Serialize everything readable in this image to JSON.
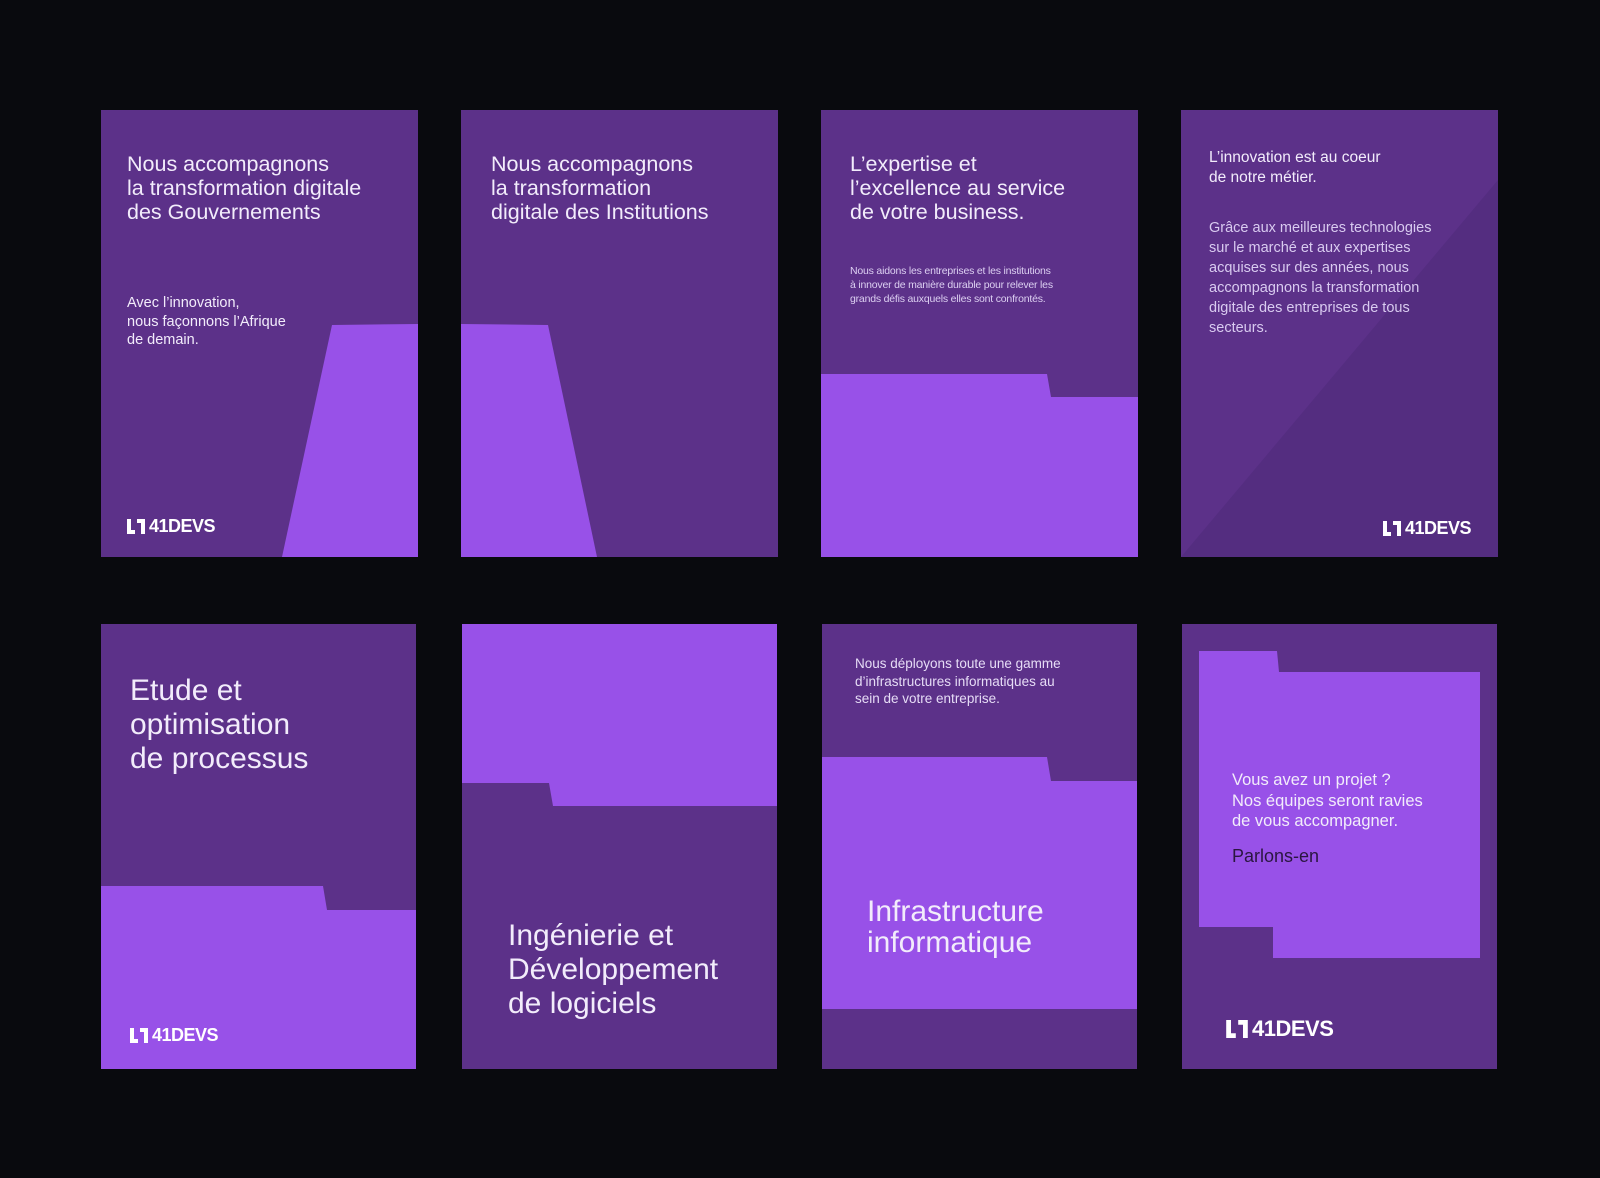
{
  "brand": {
    "logo_text": "41DEVS",
    "colors": {
      "background": "#090a0e",
      "card": "#5c3189",
      "accent": "#9851e8",
      "text": "#f2ecfb"
    }
  },
  "cards": [
    {
      "title": "Nous accompagnons\nla transformation digitale\ndes Gouvernements",
      "body": "Avec l’innovation,\nnous façonnons l’Afrique\nde demain."
    },
    {
      "title": "Nous accompagnons\nla transformation\ndigitale des Institutions"
    },
    {
      "title": "L’expertise et\nl’excellence au service\nde votre business.",
      "body": "Nous aidons les entreprises et les institutions\nà innover de manière durable pour relever les\ngrands défis auxquels elles sont confrontés."
    },
    {
      "title": "L’innovation est au coeur\nde notre métier.",
      "body": "Grâce aux meilleures technologies\nsur le marché et aux expertises\nacquises sur des années, nous\naccompagnons la transformation\ndigitale des entreprises de tous\nsecteurs."
    },
    {
      "title": "Etude et\noptimisation\nde processus"
    },
    {
      "title": "Ingénierie et\nDéveloppement\nde logiciels"
    },
    {
      "title": "Infrastructure\ninformatique",
      "body": "Nous déployons toute une gamme\nd’infrastructures informatiques au\nsein de votre entreprise."
    },
    {
      "title": "Vous avez un projet ?\nNos équipes seront ravies\nde vous accompagner.",
      "cta": "Parlons-en"
    }
  ]
}
